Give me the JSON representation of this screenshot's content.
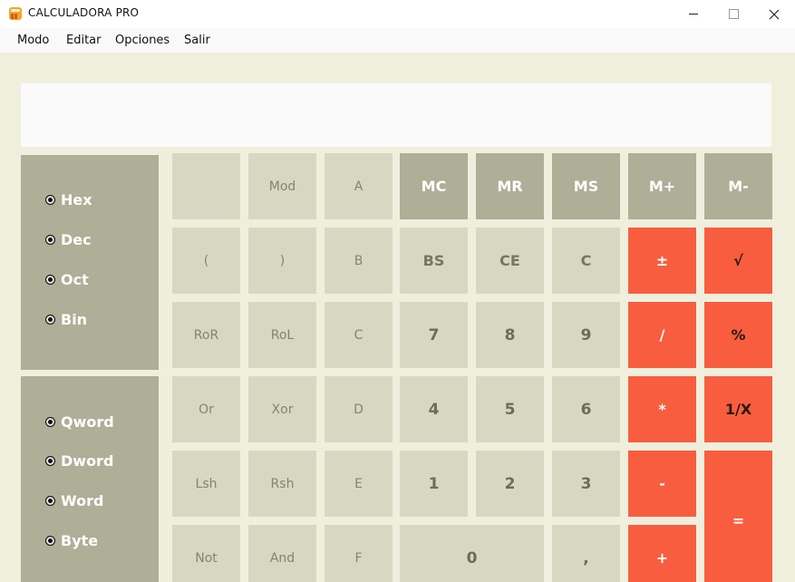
{
  "window": {
    "title": "CALCULADORA PRO",
    "icon": "calculator-app-icon",
    "controls": [
      "minimize",
      "maximize",
      "close"
    ]
  },
  "menu": [
    "Modo",
    "Editar",
    "Opciones",
    "Salir"
  ],
  "display": {
    "value": ""
  },
  "base_modes": {
    "options": [
      "Hex",
      "Dec",
      "Oct",
      "Bin"
    ]
  },
  "word_sizes": {
    "options": [
      "Qword",
      "Dword",
      "Word",
      "Byte"
    ]
  },
  "keys": {
    "r1": [
      "",
      "Mod",
      "A",
      "MC",
      "MR",
      "MS",
      "M+",
      "M-"
    ],
    "r2": [
      "(",
      ")",
      "B",
      "BS",
      "CE",
      "C",
      "±",
      "√"
    ],
    "r3": [
      "RoR",
      "RoL",
      "C",
      "7",
      "8",
      "9",
      "/",
      "%"
    ],
    "r4": [
      "Or",
      "Xor",
      "D",
      "4",
      "5",
      "6",
      "*",
      "1/X"
    ],
    "r5": [
      "Lsh",
      "Rsh",
      "E",
      "1",
      "2",
      "3",
      "-",
      "="
    ],
    "r6": [
      "Not",
      "And",
      "F",
      "0",
      ",",
      "+"
    ]
  },
  "colors": {
    "background": "#f0efdd",
    "panel": "#afae96",
    "key_light": "#d8d8c2",
    "key_accent": "#f85d3f",
    "display": "#fafafa"
  }
}
